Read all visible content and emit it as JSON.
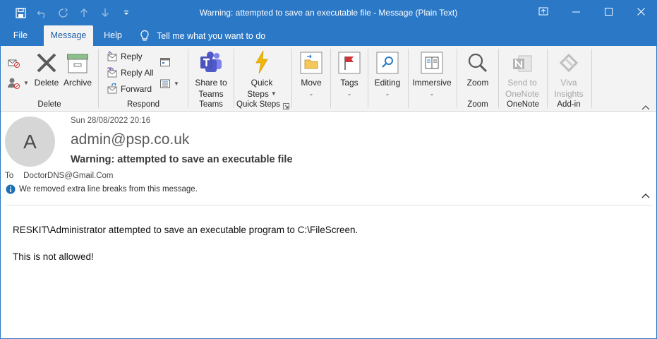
{
  "window": {
    "title": "Warning: attempted to save an executable file  -  Message (Plain Text)"
  },
  "tabs": [
    {
      "label": "File"
    },
    {
      "label": "Message"
    },
    {
      "label": "Help"
    }
  ],
  "tell_me": "Tell me what you want to do",
  "ribbon": {
    "delete_group": {
      "label": "Delete",
      "delete": "Delete",
      "archive": "Archive"
    },
    "respond_group": {
      "label": "Respond",
      "reply": "Reply",
      "reply_all": "Reply All",
      "forward": "Forward"
    },
    "teams_group": {
      "label": "Teams",
      "share1": "Share to",
      "share2": "Teams"
    },
    "quicksteps_group": {
      "label": "Quick Steps",
      "btn1": "Quick",
      "btn2": "Steps"
    },
    "move": "Move",
    "tags": "Tags",
    "editing": "Editing",
    "immersive": "Immersive",
    "zoom_group": {
      "label": "Zoom",
      "zoom": "Zoom"
    },
    "onenote_group": {
      "label": "OneNote",
      "btn1": "Send to",
      "btn2": "OneNote"
    },
    "addin_group": {
      "label": "Add-in",
      "btn1": "Viva",
      "btn2": "Insights"
    }
  },
  "message": {
    "avatar_initial": "A",
    "date": "Sun 28/08/2022 20:16",
    "sender": "admin@psp.co.uk",
    "subject": "Warning: attempted to save an executable file",
    "to_label": "To",
    "to_value": "DoctorDNS@Gmail.Com",
    "info": "We removed extra line breaks from this message.",
    "body_line1": "RESKIT\\Administrator attempted to save an executable program to C:\\FileScreen.",
    "body_line2": "This is not allowed!"
  },
  "colors": {
    "accent": "#2b78c6",
    "ribbon_bg": "#f3f3f3"
  }
}
